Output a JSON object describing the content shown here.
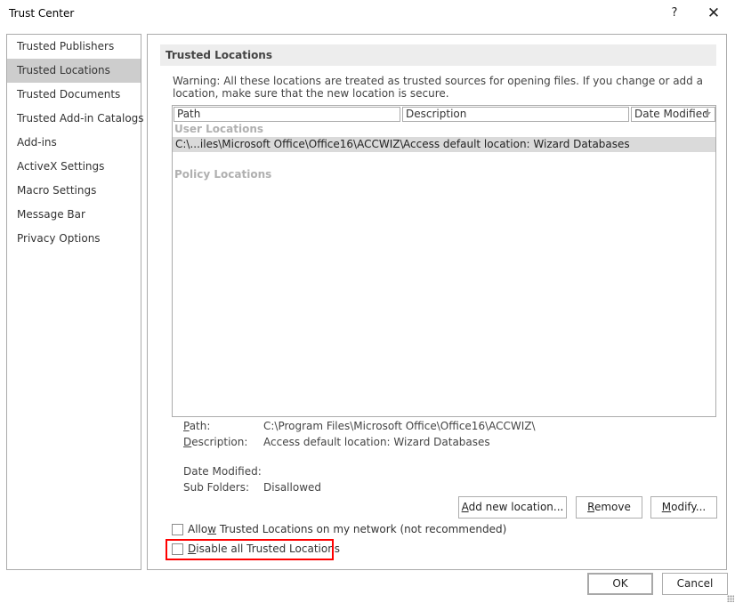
{
  "window": {
    "title": "Trust Center",
    "help_label": "?",
    "close_label": "✕"
  },
  "sidebar": {
    "items": [
      {
        "label": "Trusted Publishers",
        "selected": false
      },
      {
        "label": "Trusted Locations",
        "selected": true
      },
      {
        "label": "Trusted Documents",
        "selected": false
      },
      {
        "label": "Trusted Add-in Catalogs",
        "selected": false
      },
      {
        "label": "Add-ins",
        "selected": false
      },
      {
        "label": "ActiveX Settings",
        "selected": false
      },
      {
        "label": "Macro Settings",
        "selected": false
      },
      {
        "label": "Message Bar",
        "selected": false
      },
      {
        "label": "Privacy Options",
        "selected": false
      }
    ]
  },
  "main": {
    "section_title": "Trusted Locations",
    "warning": "Warning: All these locations are treated as trusted sources for opening files.  If you change or add a location, make sure that the new location is secure.",
    "table": {
      "columns": [
        "Path",
        "Description",
        "Date Modified"
      ],
      "user_group": "User Locations",
      "policy_group": "Policy Locations",
      "rows": [
        {
          "path": "C:\\...iles\\Microsoft Office\\Office16\\ACCWIZ\\",
          "description": "Access default location: Wizard Databases",
          "date_modified": ""
        }
      ]
    },
    "details": {
      "path_label_u": "P",
      "path_label_rest": "ath:",
      "path_value": "C:\\Program Files\\Microsoft Office\\Office16\\ACCWIZ\\",
      "description_label_u": "D",
      "description_label_rest": "escription:",
      "description_value": "Access default location: Wizard Databases",
      "date_modified_label": "Date Modified:",
      "date_modified_value": "",
      "sub_folders_label": "Sub Folders:",
      "sub_folders_value": "Disallowed"
    },
    "buttons": {
      "add_u": "A",
      "add_rest": "dd new location...",
      "remove_u": "R",
      "remove_rest": "emove",
      "modify_u": "M",
      "modify_rest": "odify..."
    },
    "checkboxes": {
      "allow_network_pre": "Allo",
      "allow_network_u": "w",
      "allow_network_post": " Trusted Locations on my network (not recommended)",
      "allow_network_checked": false,
      "disable_all_u": "D",
      "disable_all_rest": "isable all Trusted Locations",
      "disable_all_checked": false
    }
  },
  "footer": {
    "ok_label": "OK",
    "cancel_label": "Cancel"
  },
  "colors": {
    "selected_sidebar": "#cdcdcd",
    "highlight": "#ff0000",
    "section_header_bg": "#ededed",
    "selected_row": "#dadada"
  }
}
